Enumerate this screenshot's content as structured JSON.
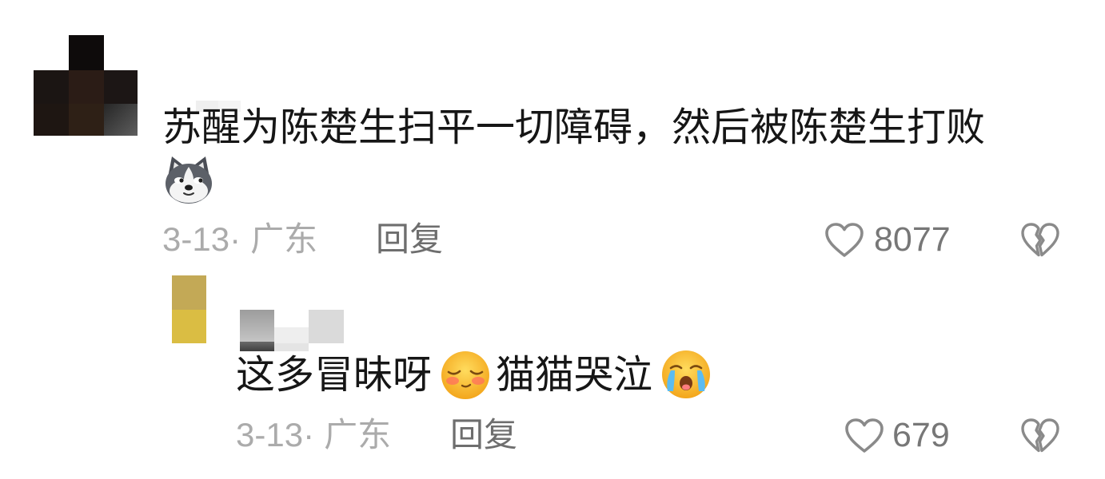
{
  "colors": {
    "background": "#ffffff",
    "text": "#161616",
    "meta": "#ababab",
    "reply_label": "#6e6e6e",
    "count": "#777777",
    "icon": "#8a8a8a"
  },
  "icons": {
    "like": "heart-outline-icon",
    "dislike": "broken-heart-icon"
  },
  "comment": {
    "text": "苏醒为陈楚生扫平一切障碍，然后被陈楚生打败",
    "emoji": "husky-face-emoji",
    "date": "3-13",
    "separator": "·",
    "location": "广东",
    "reply_label": "回复",
    "like_count": "8077"
  },
  "reply": {
    "text_1": "这多冒昧呀",
    "emoji_1": "shy-face-emoji",
    "text_2": "猫猫哭泣",
    "emoji_2": "crying-face-emoji",
    "date": "3-13",
    "separator": "·",
    "location": "广东",
    "reply_label": "回复",
    "like_count": "679"
  }
}
